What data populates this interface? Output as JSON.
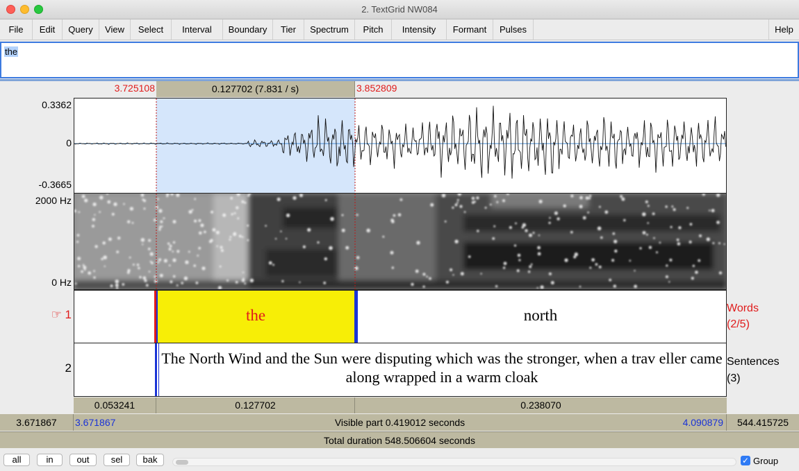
{
  "window": {
    "title": "2. TextGrid NW084"
  },
  "menus": [
    "File",
    "Edit",
    "Query",
    "View",
    "Select",
    "Interval",
    "Boundary",
    "Tier",
    "Spectrum",
    "Pitch",
    "Intensity",
    "Formant",
    "Pulses"
  ],
  "help_menu": "Help",
  "text_field": {
    "value": "the"
  },
  "selection": {
    "start": "3.725108",
    "duration": "0.127702 (7.831 / s)",
    "end": "3.852809"
  },
  "waveform": {
    "y_max": "0.3362",
    "y_zero": "0",
    "y_min": "-0.3665"
  },
  "spectrogram": {
    "f_max": "2000 Hz",
    "f_min": "0 Hz"
  },
  "tiers": [
    {
      "number": "☞ 1",
      "name": "Words",
      "count": "(2/5)",
      "intervals": [
        "",
        "the",
        "north"
      ]
    },
    {
      "number": "2",
      "name": "Sentences",
      "count": "(3)",
      "intervals": [
        "",
        "The North Wind and the Sun were disputing which was the stronger, when a trav eller came along wrapped in a warm cloak"
      ]
    }
  ],
  "durations": [
    "0.053241",
    "0.127702",
    "0.238070"
  ],
  "visible": {
    "left_total": "3.671867",
    "left_window": "3.671867",
    "label": "Visible part 0.419012 seconds",
    "right_window": "4.090879",
    "right_total": "544.415725"
  },
  "total": {
    "label": "Total duration 548.506604 seconds"
  },
  "buttons": [
    "all",
    "in",
    "out",
    "sel",
    "bak"
  ],
  "group": {
    "label": "Group",
    "checked": true
  },
  "colors": {
    "selection": "#d5e6fb",
    "interval_highlight": "#f7ee06",
    "accent_red": "#e01b1b",
    "accent_blue": "#1a33d6"
  }
}
